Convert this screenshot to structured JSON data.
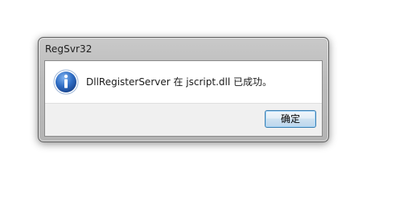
{
  "window": {
    "title": "RegSvr32"
  },
  "message": {
    "text": "DllRegisterServer 在 jscript.dll 已成功。",
    "icon": "info-icon"
  },
  "buttons": {
    "ok_label": "确定"
  },
  "colors": {
    "icon_blue": "#2f6dc4",
    "button_border": "#3c7fb1"
  }
}
